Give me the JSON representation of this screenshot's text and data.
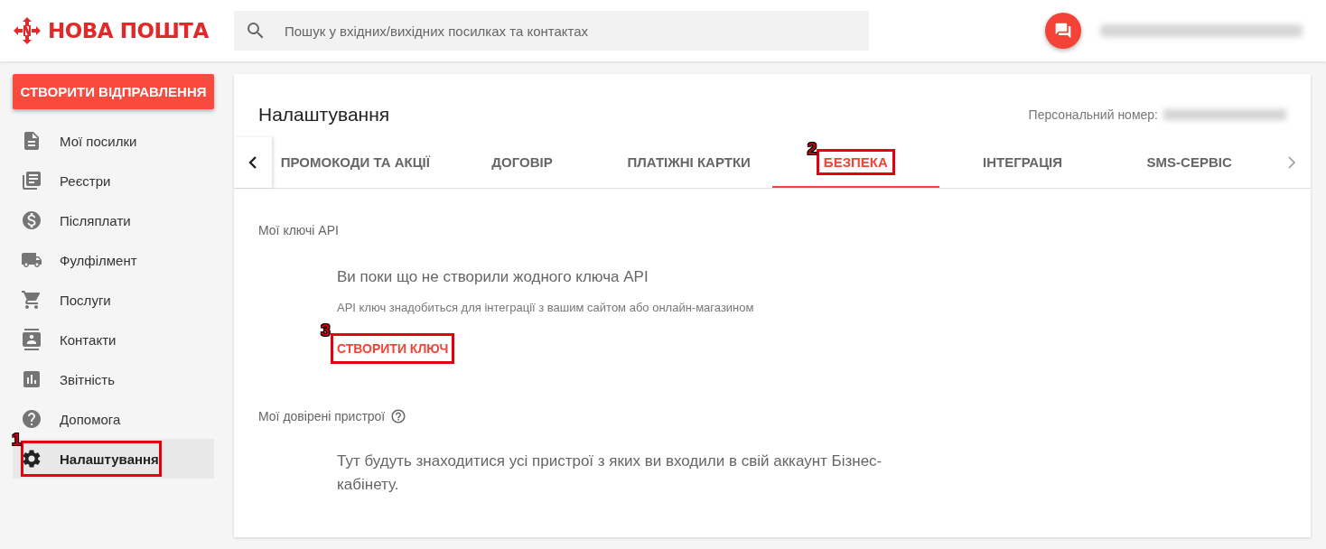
{
  "header": {
    "logo": "НОВА ПОШТА",
    "search": {
      "placeholder": "Пошук у вхідних/вихідних посилках та контактах"
    }
  },
  "sidebar": {
    "create_button": "СТВОРИТИ ВІДПРАВЛЕННЯ",
    "items": [
      {
        "label": "Мої посилки",
        "selected": false
      },
      {
        "label": "Реєстри",
        "selected": false
      },
      {
        "label": "Післяплати",
        "selected": false
      },
      {
        "label": "Фулфілмент",
        "selected": false
      },
      {
        "label": "Послуги",
        "selected": false
      },
      {
        "label": "Контакти",
        "selected": false
      },
      {
        "label": "Звітність",
        "selected": false
      },
      {
        "label": "Допомога",
        "selected": false
      },
      {
        "label": "Налаштування",
        "selected": true,
        "callout": "1"
      }
    ]
  },
  "page": {
    "title": "Налаштування",
    "personal_number_label": "Персональний номер:",
    "tabs": [
      {
        "label": "ПРОМОКОДИ ТА АКЦІЇ",
        "selected": false
      },
      {
        "label": "ДОГОВІР",
        "selected": false
      },
      {
        "label": "ПЛАТІЖНІ КАРТКИ",
        "selected": false
      },
      {
        "label": "БЕЗПЕКА",
        "selected": true,
        "callout": "2"
      },
      {
        "label": "ІНТЕГРАЦІЯ",
        "selected": false
      },
      {
        "label": "SMS-СЕРВІС",
        "selected": false
      }
    ],
    "api_keys": {
      "heading": "Мої ключі API",
      "empty_title": "Ви поки що не створили жодного ключа API",
      "empty_hint": "API ключ знадобиться для інтеграції з вашим сайтом або онлайн-магазином",
      "create_button": {
        "label": "СТВОРИТИ КЛЮЧ",
        "callout": "3"
      }
    },
    "devices": {
      "heading": "Мої довірені пристрої",
      "text": "Тут будуть знаходитися усі пристрої з яких ви входили в свій аккаунт Бізнес-кабінету."
    }
  }
}
